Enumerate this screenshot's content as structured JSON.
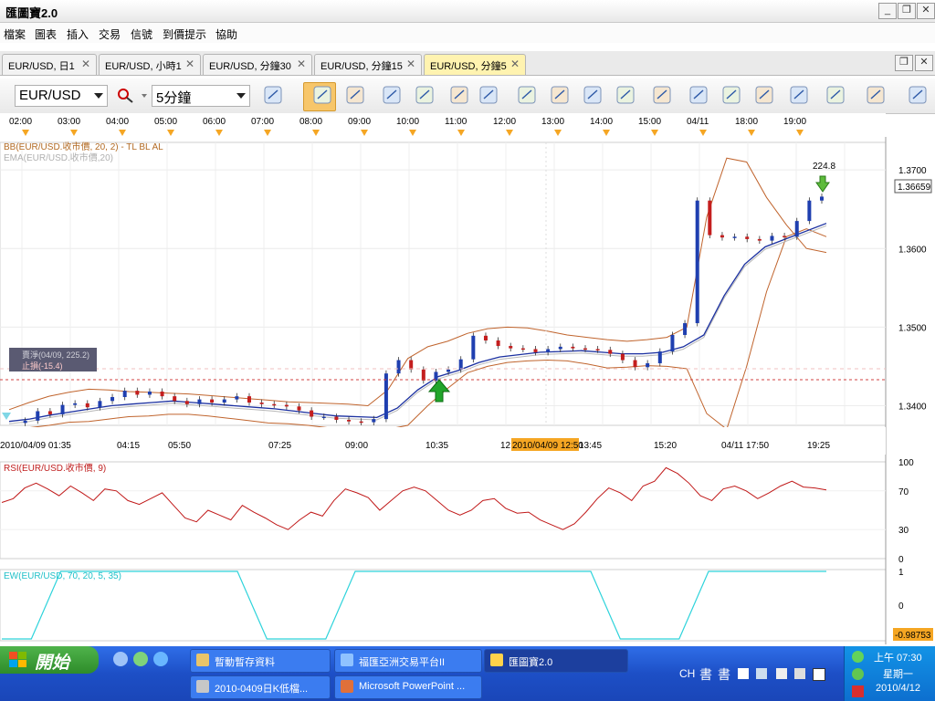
{
  "app": {
    "title": "匯圖寶2.0"
  },
  "window_buttons": [
    "_",
    "❐",
    "✕"
  ],
  "menu": [
    "檔案",
    "圖表",
    "插入",
    "交易",
    "信號",
    "到價提示",
    "協助"
  ],
  "tabs": [
    {
      "label": "EUR/USD, 日1",
      "active": false
    },
    {
      "label": "EUR/USD, 小時1",
      "active": false
    },
    {
      "label": "EUR/USD, 分鐘30",
      "active": false
    },
    {
      "label": "EUR/USD, 分鐘15",
      "active": false
    },
    {
      "label": "EUR/USD, 分鐘5",
      "active": true
    }
  ],
  "toolbar": {
    "symbol": "EUR/USD",
    "timeframe": "5分鐘",
    "tools": [
      "line-chart-icon",
      "zoom-icon",
      "bar-chart-icon",
      "candle-chart-icon",
      "person-icon",
      "person-plus-icon",
      "pointer-icon",
      "zoom-in-icon",
      "crosshair-icon",
      "edit-icon",
      "eye-icon",
      "globe-icon",
      "ruler-icon",
      "image-icon",
      "window-icon",
      "fork-icon",
      "split-icon",
      "trend-icon",
      "pen-icon"
    ]
  },
  "time_axis": [
    "02:00",
    "03:00",
    "04:00",
    "05:00",
    "06:00",
    "07:00",
    "08:00",
    "09:00",
    "10:00",
    "11:00",
    "12:00",
    "13:00",
    "14:00",
    "15:00",
    "04/11",
    "18:00",
    "19:00"
  ],
  "chart_data": [
    {
      "type": "line",
      "title": "",
      "indicator_labels": {
        "bb": "BB(EUR/USD.收市價, 20, 2) - TL BL AL",
        "ema": "EMA(EUR/USD.收市價,20)"
      },
      "price_axis": [
        "1.3700",
        "1.3600",
        "1.3500",
        "1.3400"
      ],
      "current_price": "1.36659",
      "date_axis": [
        "2010/04/09 01:35",
        "04:15",
        "05:50",
        "07:25",
        "09:00",
        "10:35",
        "12:",
        "13:45",
        "15:20",
        "04/11 17:50",
        "19:25"
      ],
      "crosshair_date": "2010/04/09 12:50",
      "annotation_text": "224.8",
      "order_labels": {
        "limit": "賣淨(04/09, 225.2)",
        "stop": "止損(-15.4)"
      },
      "ylim": [
        1.3375,
        1.3735
      ],
      "series": [
        {
          "name": "EUR/USD",
          "values": [
            1.3378,
            1.3381,
            1.3393,
            1.3389,
            1.3401,
            1.3403,
            1.3398,
            1.3406,
            1.3411,
            1.3419,
            1.3414,
            1.3418,
            1.3412,
            1.3406,
            1.3402,
            1.3408,
            1.3404,
            1.3408,
            1.3412,
            1.3404,
            1.3402,
            1.3401,
            1.3399,
            1.3394,
            1.3386,
            1.3386,
            1.3382,
            1.338,
            1.3379,
            1.3383,
            1.3441,
            1.3458,
            1.3446,
            1.3432,
            1.3443,
            1.3446,
            1.3459,
            1.3489,
            1.3483,
            1.3476,
            1.3473,
            1.3472,
            1.3468,
            1.3472,
            1.3475,
            1.3473,
            1.3472,
            1.3471,
            1.3466,
            1.3458,
            1.3449,
            1.3454,
            1.3469,
            1.349,
            1.3505,
            1.3661,
            1.3617,
            1.3614,
            1.3615,
            1.3612,
            1.361,
            1.3616,
            1.3615,
            1.3635,
            1.3661,
            1.3666
          ]
        },
        {
          "name": "EMA",
          "values": [
            1.338,
            1.3383,
            1.3388,
            1.3392,
            1.3396,
            1.34,
            1.3402,
            1.3404,
            1.3406,
            1.3404,
            1.3402,
            1.34,
            1.3398,
            1.3396,
            1.3393,
            1.339,
            1.3387,
            1.3386,
            1.3385,
            1.3397,
            1.342,
            1.3437,
            1.3445,
            1.3455,
            1.3462,
            1.3465,
            1.3468,
            1.3469,
            1.347,
            1.3468,
            1.3466,
            1.3466,
            1.3468,
            1.3475,
            1.349,
            1.354,
            1.358,
            1.3602,
            1.3612,
            1.3622,
            1.3632
          ]
        },
        {
          "name": "BB Upper",
          "values": [
            1.3395,
            1.3404,
            1.3412,
            1.3417,
            1.3421,
            1.342,
            1.3418,
            1.3417,
            1.3416,
            1.3415,
            1.3413,
            1.3411,
            1.3409,
            1.3407,
            1.3405,
            1.3404,
            1.3403,
            1.3402,
            1.34,
            1.342,
            1.346,
            1.3475,
            1.3482,
            1.3492,
            1.3498,
            1.35,
            1.3499,
            1.3495,
            1.349,
            1.3487,
            1.3484,
            1.3482,
            1.3484,
            1.3487,
            1.35,
            1.364,
            1.3715,
            1.371,
            1.3665,
            1.363,
            1.36,
            1.3595
          ]
        },
        {
          "name": "BB Lower",
          "values": [
            1.337,
            1.3372,
            1.3375,
            1.3379,
            1.338,
            1.3383,
            1.3386,
            1.3387,
            1.3389,
            1.3389,
            1.3387,
            1.3384,
            1.3381,
            1.3378,
            1.3377,
            1.3375,
            1.3372,
            1.337,
            1.3368,
            1.337,
            1.3375,
            1.34,
            1.3422,
            1.3442,
            1.345,
            1.3455,
            1.3457,
            1.3458,
            1.3457,
            1.3453,
            1.3448,
            1.3449,
            1.3451,
            1.345,
            1.3447,
            1.339,
            1.337,
            1.345,
            1.3545,
            1.3615,
            1.3625,
            1.3615
          ]
        }
      ]
    },
    {
      "type": "line",
      "title": "RSI(EUR/USD.收市價, 9)",
      "ylim": [
        0,
        100
      ],
      "y_ticks": [
        "100",
        "70",
        "30",
        "0"
      ],
      "series": [
        {
          "name": "RSI",
          "values": [
            58,
            62,
            73,
            78,
            72,
            65,
            75,
            68,
            60,
            72,
            70,
            60,
            56,
            62,
            68,
            55,
            42,
            38,
            50,
            45,
            40,
            55,
            48,
            42,
            35,
            30,
            40,
            48,
            44,
            60,
            72,
            68,
            63,
            50,
            60,
            70,
            74,
            70,
            60,
            50,
            45,
            50,
            60,
            62,
            52,
            47,
            48,
            40,
            35,
            30,
            36,
            48,
            62,
            73,
            68,
            60,
            75,
            80,
            94,
            88,
            78,
            65,
            60,
            72,
            75,
            70,
            62,
            68,
            75,
            80,
            74,
            73,
            71
          ]
        }
      ]
    },
    {
      "type": "line",
      "title": "EW(EUR/USD, 70, 20, 5, 35)",
      "ylim": [
        -1,
        1
      ],
      "y_ticks": [
        "1",
        "0"
      ],
      "current_value": "-0.98753",
      "series": [
        {
          "name": "EW",
          "values": [
            -1,
            -1,
            1,
            1,
            1,
            1,
            1,
            1,
            1,
            -1,
            -1,
            -1,
            1,
            1,
            1,
            1,
            1,
            1,
            1,
            1,
            1,
            -1,
            -1,
            -1,
            1,
            1,
            1,
            1,
            1
          ]
        }
      ]
    }
  ],
  "taskbar": {
    "start_label": "開始",
    "tasks": [
      {
        "label": "暫動暫存資料",
        "active": false
      },
      {
        "label": "福匯亞洲交易平台II",
        "active": false
      },
      {
        "label": "匯圖寶2.0",
        "active": true
      },
      {
        "label": "2010-0409日K低檔...",
        "active": false
      },
      {
        "label": "Microsoft PowerPoint ...",
        "active": false
      }
    ],
    "ime": [
      "CH",
      "書",
      "書"
    ],
    "clock": {
      "time": "上午 07:30",
      "day": "星期一",
      "date": "2010/4/12"
    }
  }
}
